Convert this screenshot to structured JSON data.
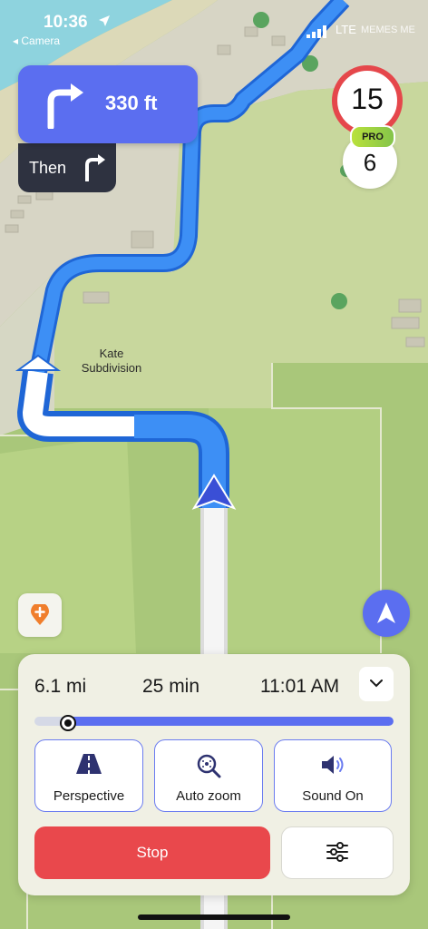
{
  "status_bar": {
    "time": "10:36",
    "back_label": "◂ Camera",
    "network": "LTE",
    "carrier": "MEMES ME"
  },
  "navigation": {
    "turn_distance": "330 ft",
    "then_label": "Then"
  },
  "speed": {
    "limit": "15",
    "current": "6",
    "badge": "PRO"
  },
  "map": {
    "place_label": "Kate Subdivision"
  },
  "trip": {
    "distance": "6.1 mi",
    "duration": "25 min",
    "arrival": "11:01 AM",
    "progress": 0.09
  },
  "options": [
    {
      "label": "Perspective",
      "icon": "road-perspective-icon"
    },
    {
      "label": "Auto zoom",
      "icon": "auto-zoom-icon"
    },
    {
      "label": "Sound On",
      "icon": "speaker-icon"
    }
  ],
  "actions": {
    "stop_label": "Stop",
    "settings_icon": "sliders-icon"
  },
  "colors": {
    "accent": "#5b6ef0",
    "stop": "#e9484c",
    "speed_limit_ring": "#e5474b",
    "then_card": "#2e3240",
    "map_grass": "#a9c77a",
    "water": "#8ed3de"
  }
}
